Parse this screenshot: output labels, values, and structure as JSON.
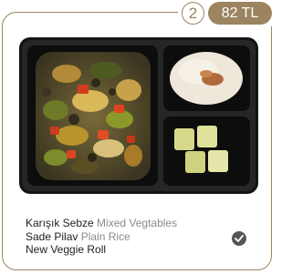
{
  "order": {
    "quantity": "2",
    "price": "82 TL"
  },
  "menu": {
    "items": [
      {
        "name_tr": "Karışık Sebze",
        "name_en": "Mixed Vegtables"
      },
      {
        "name_tr": "Sade Pilav",
        "name_en": "Plain Rice"
      },
      {
        "name_tr": "New Veggie Roll",
        "name_en": ""
      }
    ]
  },
  "icons": {
    "selected": "check-circle-icon"
  },
  "colors": {
    "accent": "#9b845f",
    "tray": "#1a1a1a",
    "text": "#1e1e1e",
    "secondary_text": "#8a8a8a"
  }
}
